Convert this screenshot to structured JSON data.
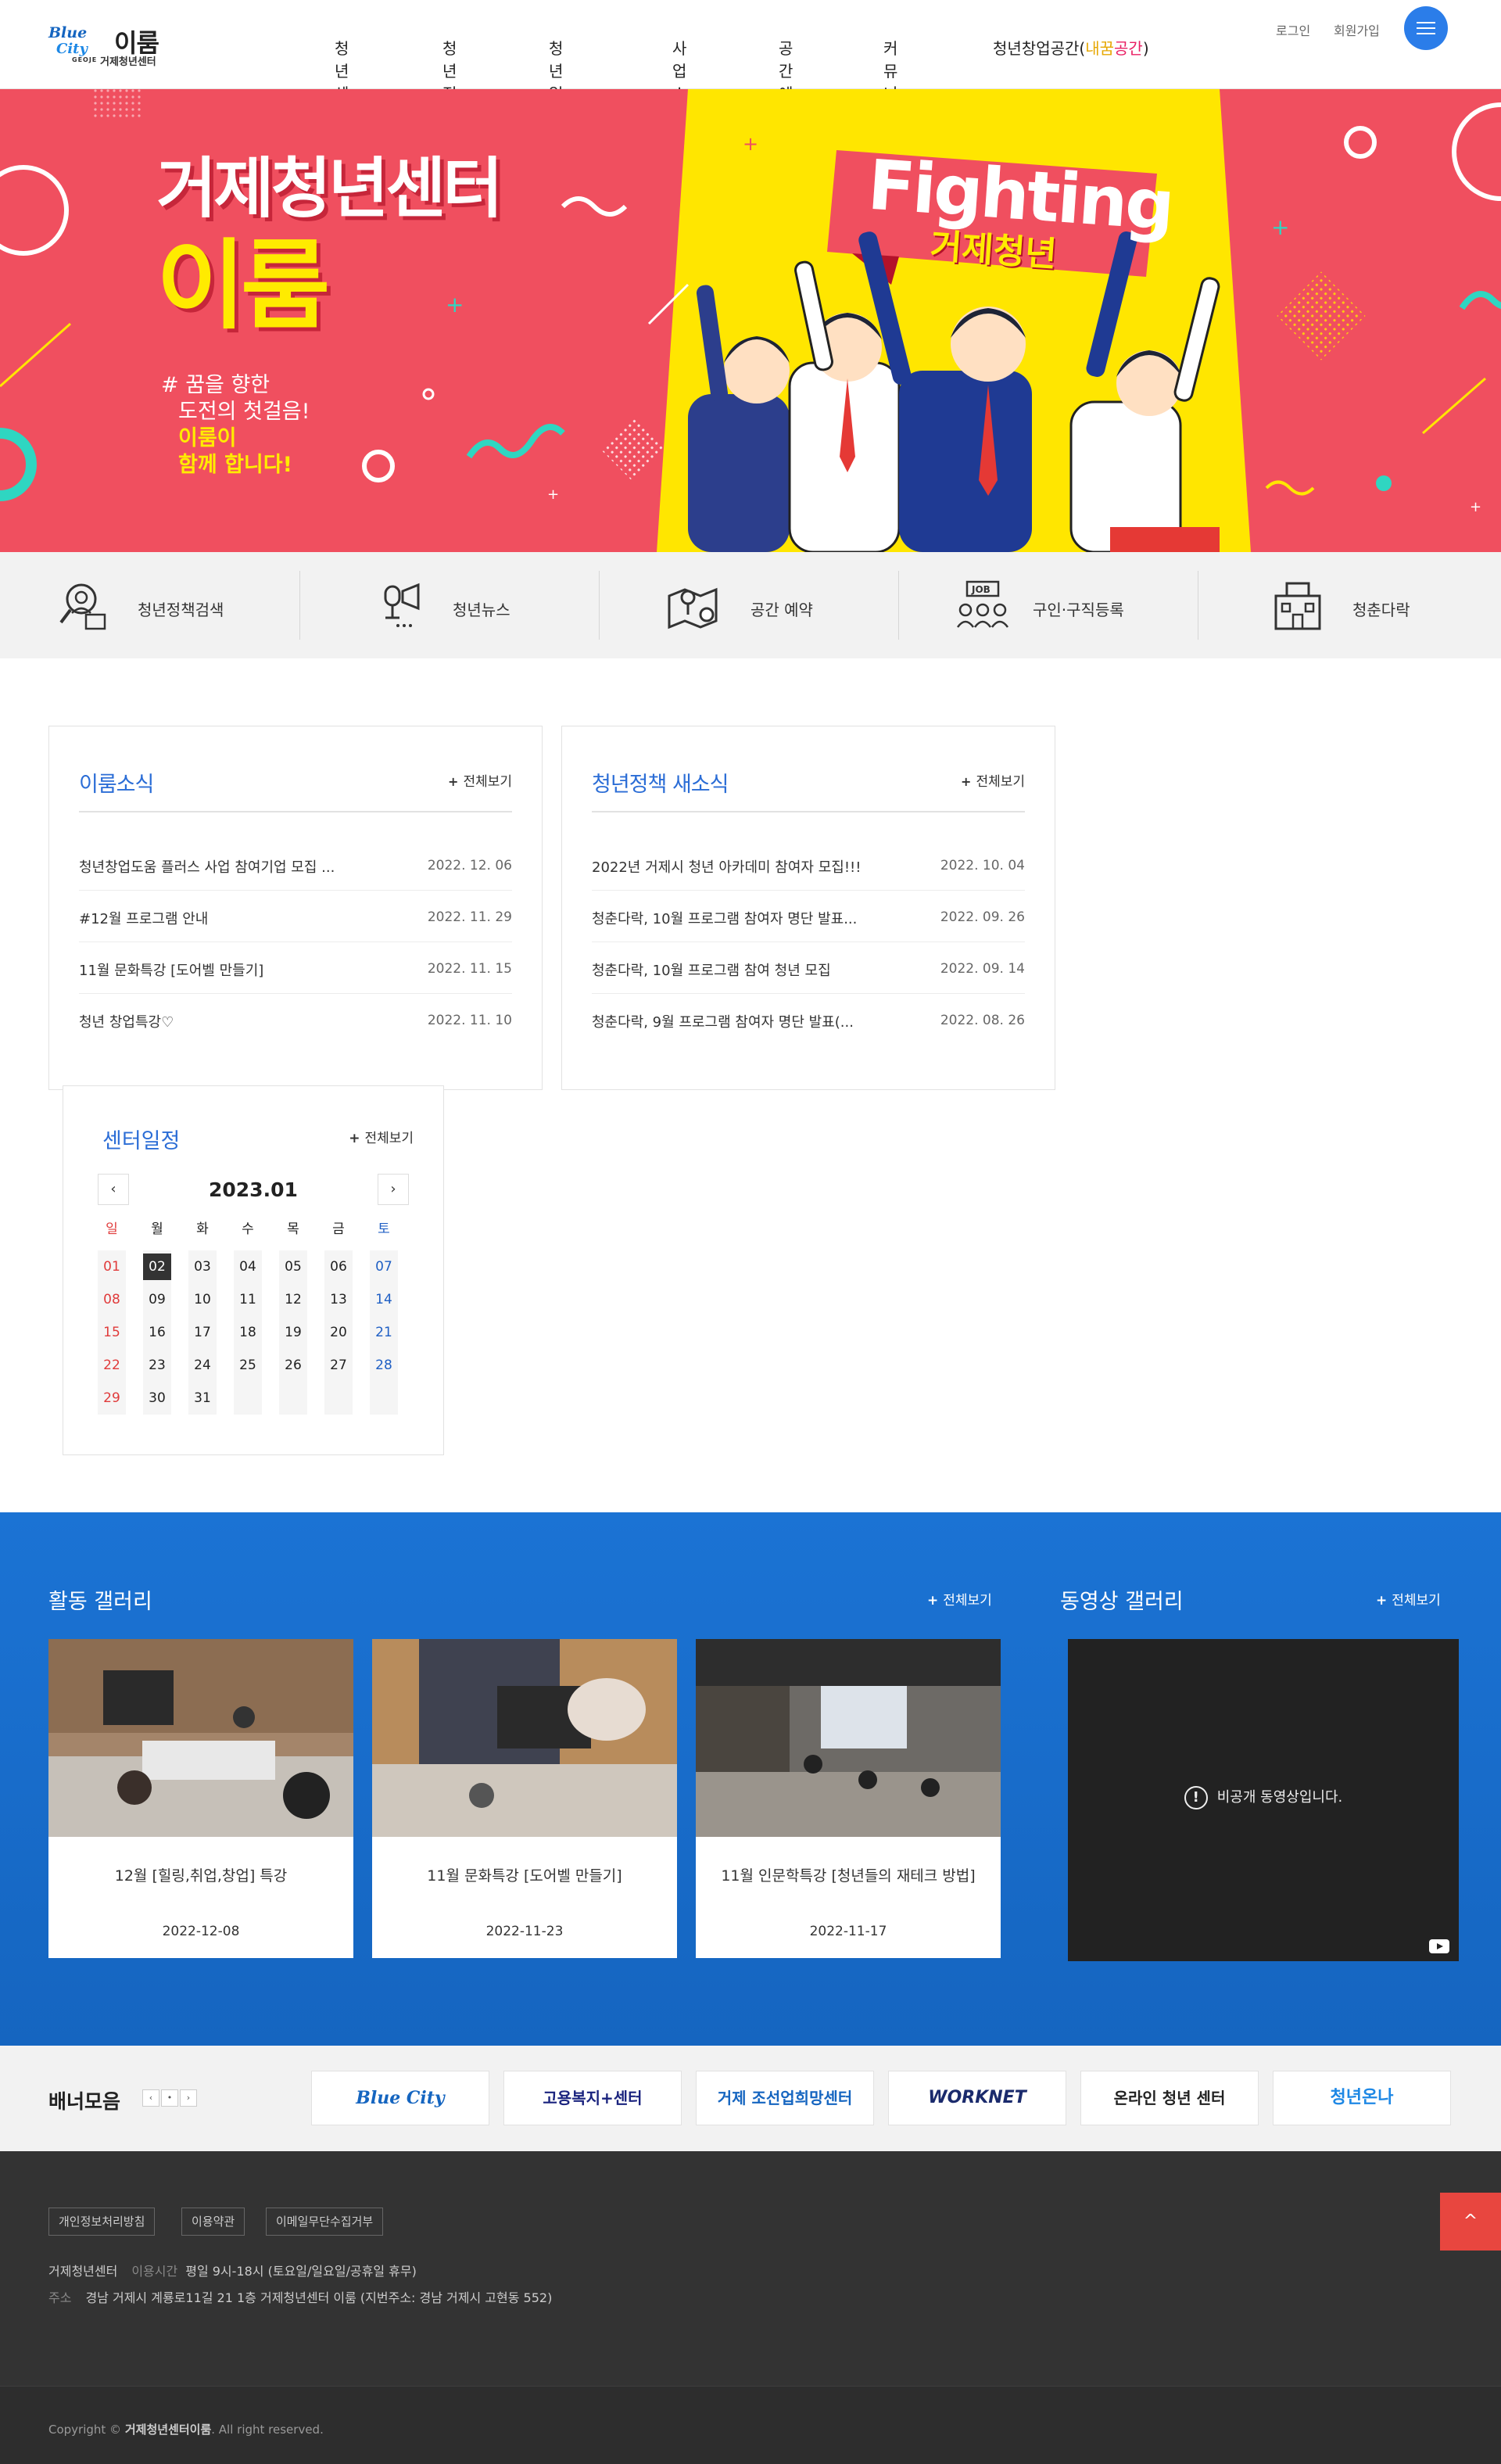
{
  "header": {
    "logo_en_1": "Blue",
    "logo_en_2": "City",
    "logo_geoje": "GEOJE",
    "logo_ko": "이룸",
    "logo_sub": "거제청년센터",
    "nav": [
      "청년센터",
      "청년정책",
      "청년일자리",
      "사업소개",
      "공간예약",
      "커뮤니티"
    ],
    "nav_last_prefix": "청년창업공간(",
    "nav_last_hl1": "내꿈",
    "nav_last_hl2": "공간",
    "nav_last_suffix": ")",
    "login": "로그인",
    "join": "회원가입"
  },
  "hero": {
    "title1": "거제청년센터",
    "title2": "이룸",
    "slogan1": "# 꿈을 향한",
    "slogan2": "도전의 첫걸음!",
    "slogan3": "이룸이",
    "slogan4": "함께 합니다!",
    "fighting": "Fighting",
    "fighting_sub": "거제청년"
  },
  "quick_menu": [
    {
      "label": "청년정책검색",
      "icon": "search-person-icon"
    },
    {
      "label": "청년뉴스",
      "icon": "megaphone-icon"
    },
    {
      "label": "공간 예약",
      "icon": "map-location-icon"
    },
    {
      "label": "구인·구직등록",
      "icon": "job-people-icon"
    },
    {
      "label": "청춘다락",
      "icon": "building-icon"
    }
  ],
  "board_news": {
    "title": "이룸소식",
    "more": "전체보기",
    "rows": [
      {
        "title": "청년창업도움 플러스 사업 참여기업 모집 ...",
        "date": "2022. 12. 06"
      },
      {
        "title": "#12월 프로그램 안내",
        "date": "2022. 11. 29"
      },
      {
        "title": "11월 문화특강 [도어벨 만들기]",
        "date": "2022. 11. 15"
      },
      {
        "title": "청년 창업특강♡",
        "date": "2022. 11. 10"
      }
    ]
  },
  "board_policy": {
    "title": "청년정책 새소식",
    "more": "전체보기",
    "rows": [
      {
        "title": "2022년 거제시 청년 아카데미 참여자 모집!!!",
        "date": "2022. 10. 04"
      },
      {
        "title": "청춘다락, 10월 프로그램 참여자 명단 발표...",
        "date": "2022. 09. 26"
      },
      {
        "title": "청춘다락, 10월 프로그램 참여 청년 모집",
        "date": "2022. 09. 14"
      },
      {
        "title": "청춘다락, 9월 프로그램 참여자 명단 발표(...",
        "date": "2022. 08. 26"
      }
    ]
  },
  "calendar": {
    "title": "센터일정",
    "more": "전체보기",
    "month": "2023.01",
    "prev": "‹",
    "next": "›",
    "weekdays": [
      "일",
      "월",
      "화",
      "수",
      "목",
      "금",
      "토"
    ],
    "days": [
      "01",
      "02",
      "03",
      "04",
      "05",
      "06",
      "07",
      "08",
      "09",
      "10",
      "11",
      "12",
      "13",
      "14",
      "15",
      "16",
      "17",
      "18",
      "19",
      "20",
      "21",
      "22",
      "23",
      "24",
      "25",
      "26",
      "27",
      "28",
      "29",
      "30",
      "31"
    ],
    "today": "02"
  },
  "gallery": {
    "title": "활동 갤러리",
    "more": "전체보기",
    "items": [
      {
        "title": "12월 [힐링,취업,창업] 특강",
        "date": "2022-12-08"
      },
      {
        "title": "11월 문화특강 [도어벨 만들기]",
        "date": "2022-11-23"
      },
      {
        "title": "11월 인문학특강 [청년들의 재테크 방법]",
        "date": "2022-11-17"
      }
    ]
  },
  "video": {
    "title": "동영상 갤러리",
    "more": "전체보기",
    "message": "비공개 동영상입니다.",
    "icon": "!"
  },
  "banners": {
    "title": "배너모음",
    "controls": [
      "‹",
      "•",
      "›"
    ],
    "items": [
      {
        "text": "Blue City"
      },
      {
        "text": "고용복지+센터"
      },
      {
        "text": "거제 조선업희망센터"
      },
      {
        "text": "WORKNET"
      },
      {
        "text": "온라인 청년 센터"
      },
      {
        "text": "청년온나"
      }
    ]
  },
  "footer": {
    "links": [
      "개인정보처리방침",
      "이용약관",
      "이메일무단수집거부"
    ],
    "org": "거제청년센터",
    "hours_label": "이용시간",
    "hours": "평일 9시-18시 (토요일/일요일/공휴일 휴무)",
    "addr_label": "주소",
    "addr": "경남 거제시 계룡로11길 21 1층 거제청년센터 이룸 (지번주소: 경남 거제시 고현동 552)",
    "copy_prefix": "Copyright ©",
    "copy_org": "거제청년센터이룸",
    "copy_suffix": ". All right reserved.",
    "top_button": "^"
  },
  "colors": {
    "primary": "#2b6dd6",
    "hero_bg": "#f04f5f",
    "hero_yellow": "#ffeb00",
    "gallery_bg": "#1b73d4",
    "footer_bg": "#333333",
    "top_button": "#e8463f"
  }
}
